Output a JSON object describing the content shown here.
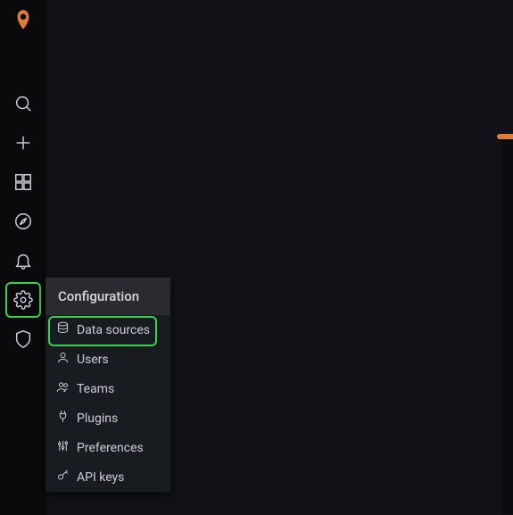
{
  "sidebar": {
    "logo_name": "grafana-logo",
    "items": [
      {
        "name": "search-icon"
      },
      {
        "name": "create-icon"
      },
      {
        "name": "dashboards-icon"
      },
      {
        "name": "explore-icon"
      },
      {
        "name": "alerting-icon"
      },
      {
        "name": "configuration-icon"
      },
      {
        "name": "server-admin-icon"
      }
    ]
  },
  "config_menu": {
    "title": "Configuration",
    "items": [
      {
        "label": "Data sources",
        "icon": "database-icon"
      },
      {
        "label": "Users",
        "icon": "user-icon"
      },
      {
        "label": "Teams",
        "icon": "users-icon"
      },
      {
        "label": "Plugins",
        "icon": "plug-icon"
      },
      {
        "label": "Preferences",
        "icon": "sliders-icon"
      },
      {
        "label": "API keys",
        "icon": "key-icon"
      }
    ]
  }
}
